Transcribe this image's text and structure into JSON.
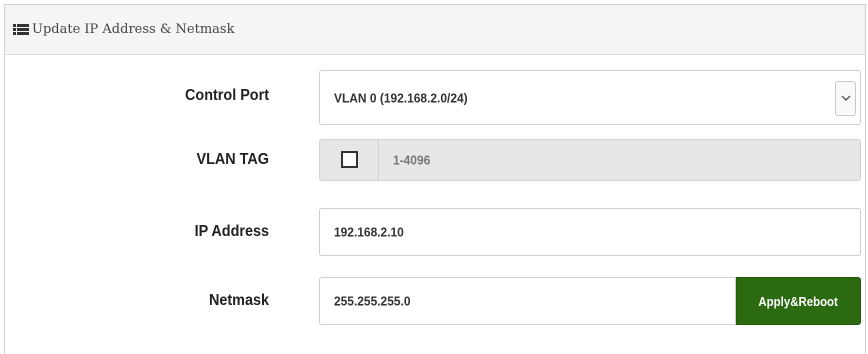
{
  "panel": {
    "title": "Update IP Address & Netmask",
    "icon": "list-icon"
  },
  "form": {
    "control_port": {
      "label": "Control Port",
      "selected": "VLAN 0 (192.168.2.0/24)",
      "icon": "chevron-down-icon"
    },
    "vlan_tag": {
      "label": "VLAN TAG",
      "checked": false,
      "placeholder": "1-4096"
    },
    "ip_address": {
      "label": "IP Address",
      "value": "192.168.2.10"
    },
    "netmask": {
      "label": "Netmask",
      "value": "255.255.255.0"
    },
    "apply_button": {
      "label": "Apply&Reboot",
      "color": "#2b6a10"
    }
  }
}
